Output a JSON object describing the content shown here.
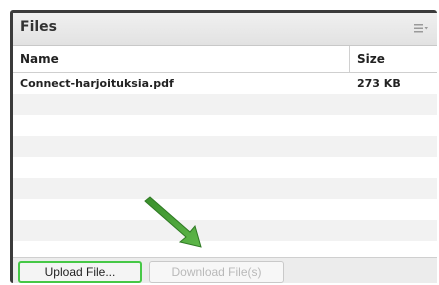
{
  "panel": {
    "title": "Files",
    "menu_icon": "hamburger-dropdown-icon"
  },
  "table": {
    "columns": [
      "Name",
      "Size"
    ],
    "rows": [
      {
        "name": "Connect-harjoituksia.pdf",
        "size": "273 KB"
      }
    ]
  },
  "footer": {
    "upload_label": "Upload File...",
    "download_label": "Download File(s)"
  },
  "annotation": {
    "arrow_color": "#3f9a2f",
    "highlight_color": "#46c846"
  }
}
